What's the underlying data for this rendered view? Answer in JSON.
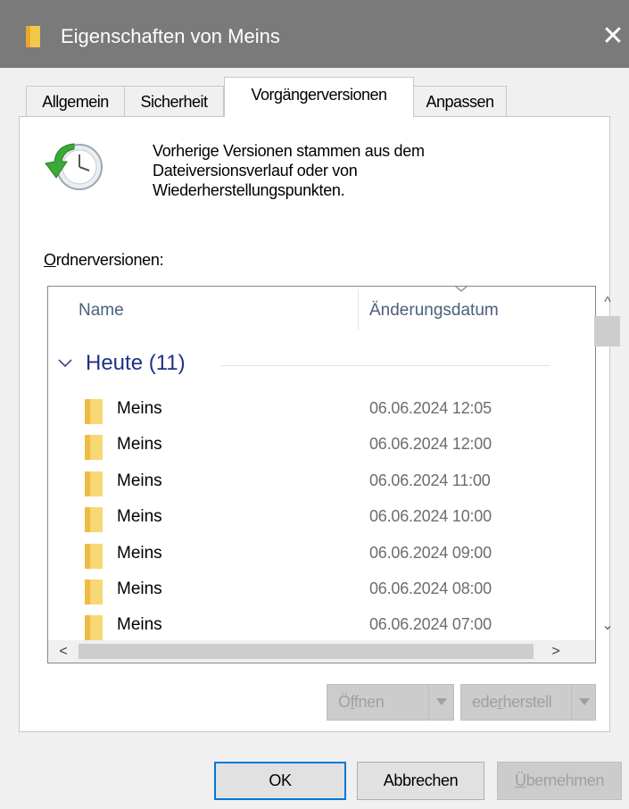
{
  "window": {
    "title": "Eigenschaften von Meins",
    "close_glyph": "✕",
    "accent_color": "#0078d7"
  },
  "tabs": [
    {
      "label": "Allgemein",
      "active": false
    },
    {
      "label": "Sicherheit",
      "active": false
    },
    {
      "label": "Vorgängerversionen",
      "active": true
    },
    {
      "label": "Anpassen",
      "active": false
    }
  ],
  "info": {
    "lines": [
      "Vorherige Versionen stammen aus dem",
      "Dateiversionsverlauf oder von",
      "Wiederherstellungspunkten."
    ],
    "icon": "restore-clock-icon"
  },
  "versions": {
    "label_accel": "O",
    "label_rest": "rdnerversionen:",
    "columns": {
      "name": "Name",
      "date": "Änderungsdatum"
    },
    "group": {
      "label": "Heute (11)"
    },
    "rows": [
      {
        "name": "Meins",
        "date": "06.06.2024 12:05"
      },
      {
        "name": "Meins",
        "date": "06.06.2024 12:00"
      },
      {
        "name": "Meins",
        "date": "06.06.2024 11:00"
      },
      {
        "name": "Meins",
        "date": "06.06.2024 10:00"
      },
      {
        "name": "Meins",
        "date": "06.06.2024 09:00"
      },
      {
        "name": "Meins",
        "date": "06.06.2024 08:00"
      },
      {
        "name": "Meins",
        "date": "06.06.2024 07:00"
      }
    ]
  },
  "scroll": {
    "up": "^",
    "down": "⌄",
    "left": "<",
    "right": ">"
  },
  "actions": {
    "open_pre": "Ö",
    "open_accel": "f",
    "open_post": "fnen",
    "restore_pre": "ede",
    "restore_accel": "r",
    "restore_post": "herstell"
  },
  "footer": {
    "ok": "OK",
    "cancel": "Abbrechen",
    "apply_accel": "Ü",
    "apply_rest": "bernehmen"
  }
}
